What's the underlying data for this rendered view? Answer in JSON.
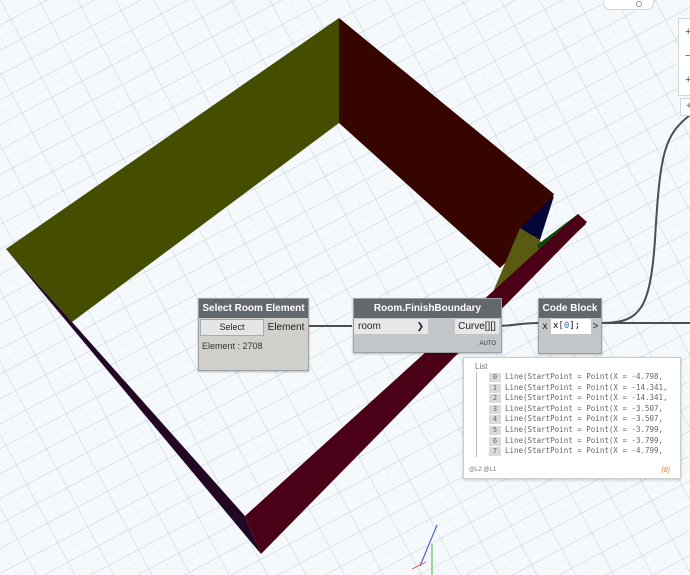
{
  "viewport": {
    "model_colors": {
      "wall_olive": "#444d00",
      "wall_dark_red": "#360500",
      "wall_maroon": "#4a0016",
      "wall_purple": "#220822",
      "accent_navy": "#040637",
      "accent_green": "#0d4a09",
      "grid": "#b4c8d6"
    }
  },
  "nodes": {
    "select_room": {
      "title": "Select Room Element",
      "button_label": "Select",
      "output_port": "Element",
      "status": "Element : 2708"
    },
    "finish_boundary": {
      "title": "Room.FinishBoundary",
      "input_port": "room",
      "output_port": "Curve[][]",
      "lacing": "AUTO"
    },
    "code_block": {
      "title": "Code Block",
      "input_port": "x",
      "code_prefix": "x",
      "code_index": "0",
      "code_suffix": ";",
      "output_port": ">"
    }
  },
  "preview": {
    "label": "List",
    "items": [
      {
        "index": "0",
        "text": "Line(StartPoint = Point(X = -4.798,"
      },
      {
        "index": "1",
        "text": "Line(StartPoint = Point(X = -14.341,"
      },
      {
        "index": "2",
        "text": "Line(StartPoint = Point(X = -14.341,"
      },
      {
        "index": "3",
        "text": "Line(StartPoint = Point(X = -3.507,"
      },
      {
        "index": "4",
        "text": "Line(StartPoint = Point(X = -3.507,"
      },
      {
        "index": "5",
        "text": "Line(StartPoint = Point(X = -3.799,"
      },
      {
        "index": "6",
        "text": "Line(StartPoint = Point(X = -3.799,"
      },
      {
        "index": "7",
        "text": "Line(StartPoint = Point(X = -4.799,"
      }
    ],
    "levels": "@L2 @L1",
    "count": "{8}"
  },
  "controls": {
    "zoom_in": "+",
    "zoom_out": "−",
    "fit": "+"
  }
}
